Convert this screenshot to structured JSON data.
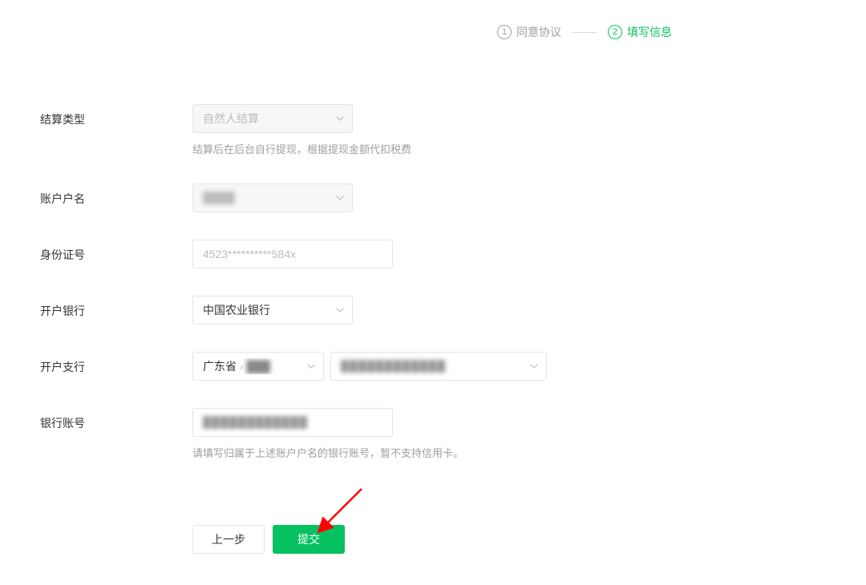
{
  "steps": {
    "s1_num": "1",
    "s1_label": "同意协议",
    "s2_num": "2",
    "s2_label": "填写信息"
  },
  "labels": {
    "settlement_type": "结算类型",
    "account_name": "账户户名",
    "id_number": "身份证号",
    "bank": "开户银行",
    "branch": "开户支行",
    "bank_account": "银行账号"
  },
  "values": {
    "settlement_type": "自然人结算",
    "account_name_masked": "████",
    "id_placeholder": "4523**********584x",
    "bank": "中国农业银行",
    "region_province": "广东省",
    "region_city_masked": "███",
    "branch_masked": "████████████",
    "bank_account_value": "████████████"
  },
  "hints": {
    "settlement": "结算后在后台自行提现，根据提现金额代扣税费",
    "bank_account": "请填写归属于上述账户户名的银行账号，暂不支持信用卡。"
  },
  "buttons": {
    "prev": "上一步",
    "submit": "提交"
  }
}
